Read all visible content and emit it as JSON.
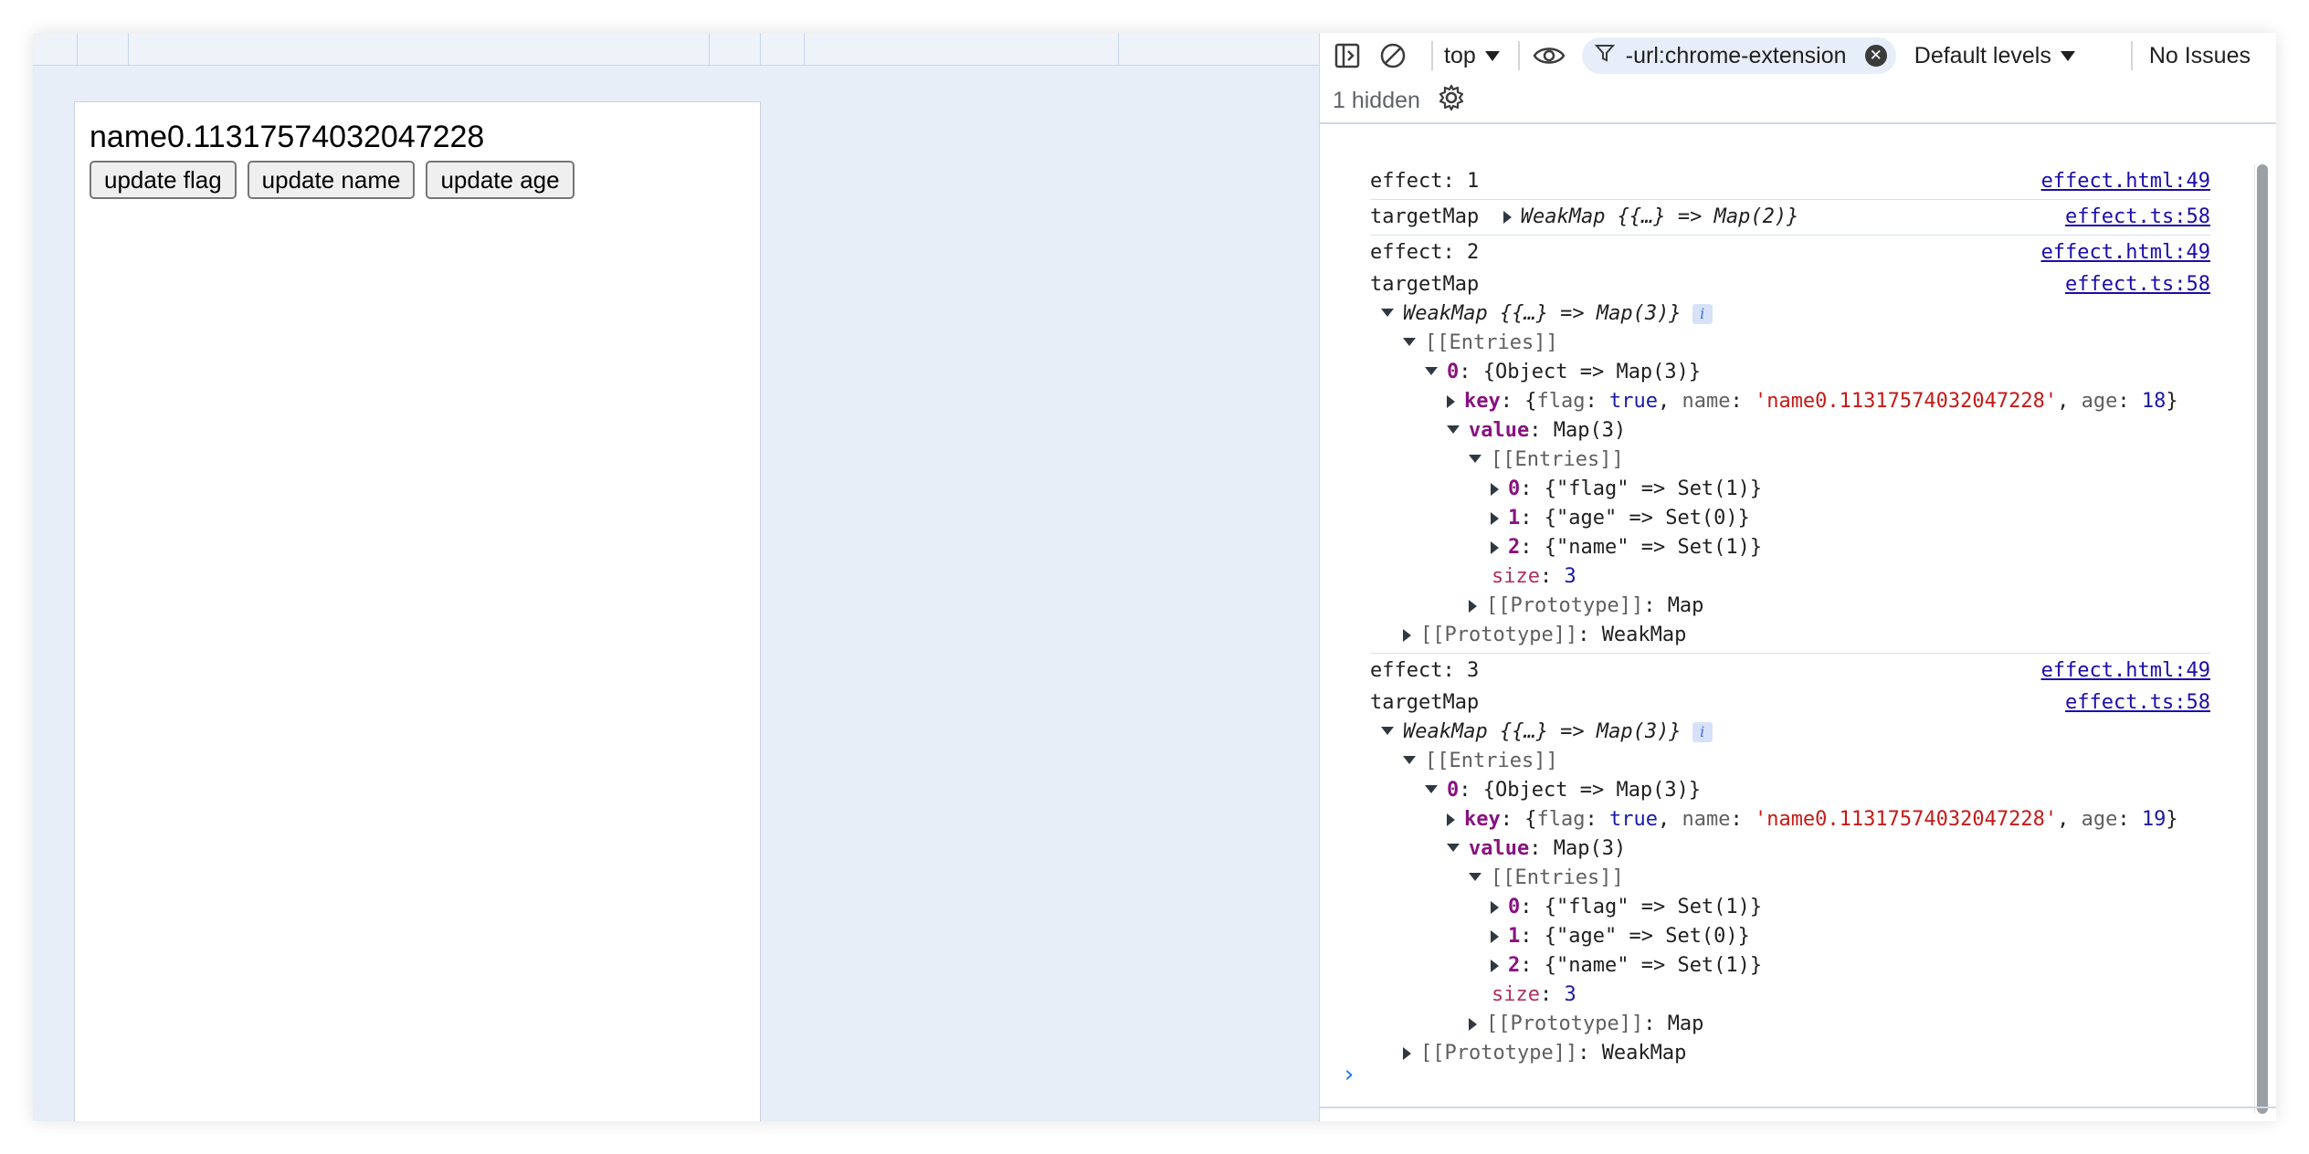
{
  "page": {
    "title": "name0.11317574032047228",
    "buttons": [
      "update flag",
      "update name",
      "update age"
    ]
  },
  "devtools": {
    "toolbar": {
      "context": "top",
      "filter_text": "-url:chrome-extension",
      "levels": "Default levels",
      "issues": "No Issues"
    },
    "hidden_text": "1 hidden",
    "logs": {
      "effect1": {
        "text": "effect: 1",
        "source": "effect.html:49"
      },
      "tm1": {
        "label": "targetMap",
        "summary": "WeakMap {{…} => Map(2)}",
        "source": "effect.ts:58"
      },
      "effect2": {
        "text": "effect: 2",
        "source": "effect.html:49"
      },
      "tm2": {
        "label": "targetMap",
        "source": "effect.ts:58",
        "summary": "WeakMap {{…} => Map(3)}",
        "entries": "[[Entries]]",
        "entry0": "{Object => Map(3)}",
        "key_age": "18",
        "value_text": "Map(3)",
        "flag_set": "{\"flag\" => Set(1)}",
        "age_set": "{\"age\" => Set(0)}",
        "name_set": "{\"name\" => Set(1)}",
        "size": "3",
        "proto_map": "Map",
        "proto_weakmap": "WeakMap"
      },
      "effect3": {
        "text": "effect: 3",
        "source": "effect.html:49"
      },
      "tm3": {
        "label": "targetMap",
        "source": "effect.ts:58",
        "summary": "WeakMap {{…} => Map(3)}",
        "entries": "[[Entries]]",
        "entry0": "{Object => Map(3)}",
        "key_age": "19",
        "value_text": "Map(3)",
        "flag_set": "{\"flag\" => Set(1)}",
        "age_set": "{\"age\" => Set(0)}",
        "name_set": "{\"name\" => Set(1)}",
        "size": "3",
        "proto_map": "Map",
        "proto_weakmap": "WeakMap"
      }
    },
    "key_flag": "true",
    "key_name": "'name0.11317574032047228'",
    "prompt": "›",
    "colors": {
      "link": "#1a0dab",
      "accent": "#1a73e8",
      "keyword": "#881280",
      "string": "#c41a16",
      "number": "#1a1aa6"
    }
  }
}
